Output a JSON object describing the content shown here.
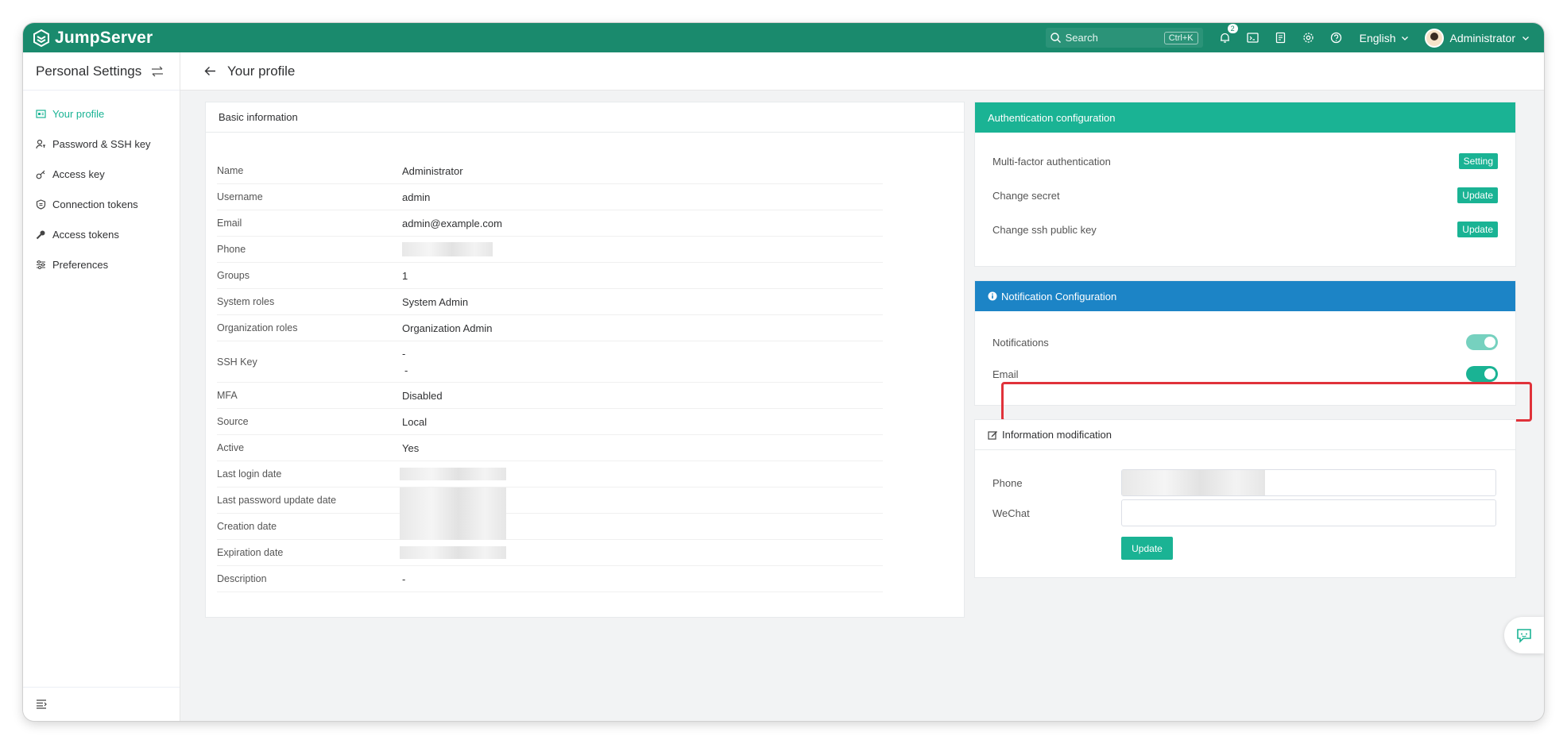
{
  "topbar": {
    "brand": "JumpServer",
    "search_placeholder": "Search",
    "search_shortcut": "Ctrl+K",
    "notification_count": "2",
    "language": "English",
    "user_name": "Administrator"
  },
  "sidebar": {
    "title": "Personal Settings",
    "items": [
      {
        "label": "Your profile",
        "icon": "profile-card-icon",
        "active": true
      },
      {
        "label": "Password & SSH key",
        "icon": "user-key-icon",
        "active": false
      },
      {
        "label": "Access key",
        "icon": "key-icon",
        "active": false
      },
      {
        "label": "Connection tokens",
        "icon": "shield-icon",
        "active": false
      },
      {
        "label": "Access tokens",
        "icon": "wrench-key-icon",
        "active": false
      },
      {
        "label": "Preferences",
        "icon": "sliders-icon",
        "active": false
      }
    ]
  },
  "page": {
    "title": "Your profile"
  },
  "basic": {
    "title": "Basic information",
    "rows": [
      {
        "label": "Name",
        "value": "Administrator"
      },
      {
        "label": "Username",
        "value": "admin"
      },
      {
        "label": "Email",
        "value": "admin@example.com"
      },
      {
        "label": "Phone",
        "value": ""
      },
      {
        "label": "Groups",
        "value": "1"
      },
      {
        "label": "System roles",
        "value": "System Admin"
      },
      {
        "label": "Organization roles",
        "value": "Organization Admin"
      },
      {
        "label": "SSH Key",
        "value": "-",
        "value2": "-"
      },
      {
        "label": "MFA",
        "value": "Disabled"
      },
      {
        "label": "Source",
        "value": "Local"
      },
      {
        "label": "Active",
        "value": "Yes"
      },
      {
        "label": "Last login date",
        "value": ""
      },
      {
        "label": "Last password update date",
        "value": ""
      },
      {
        "label": "Creation date",
        "value": ""
      },
      {
        "label": "Expiration date",
        "value": ""
      },
      {
        "label": "Description",
        "value": "-"
      }
    ]
  },
  "auth": {
    "title": "Authentication configuration",
    "rows": [
      {
        "label": "Multi-factor authentication",
        "button": "Setting"
      },
      {
        "label": "Change secret",
        "button": "Update"
      },
      {
        "label": "Change ssh public key",
        "button": "Update"
      }
    ]
  },
  "notify": {
    "title": "Notification Configuration",
    "rows": [
      {
        "label": "Notifications",
        "on": true
      },
      {
        "label": "Email",
        "on": true
      }
    ]
  },
  "modify": {
    "title": "Information modification",
    "phone_label": "Phone",
    "wechat_label": "WeChat",
    "wechat_value": "",
    "submit": "Update"
  },
  "colors": {
    "topbar": "#1a8a6d",
    "primary": "#1ab394",
    "info": "#1c84c6",
    "highlight": "#e0323a"
  }
}
